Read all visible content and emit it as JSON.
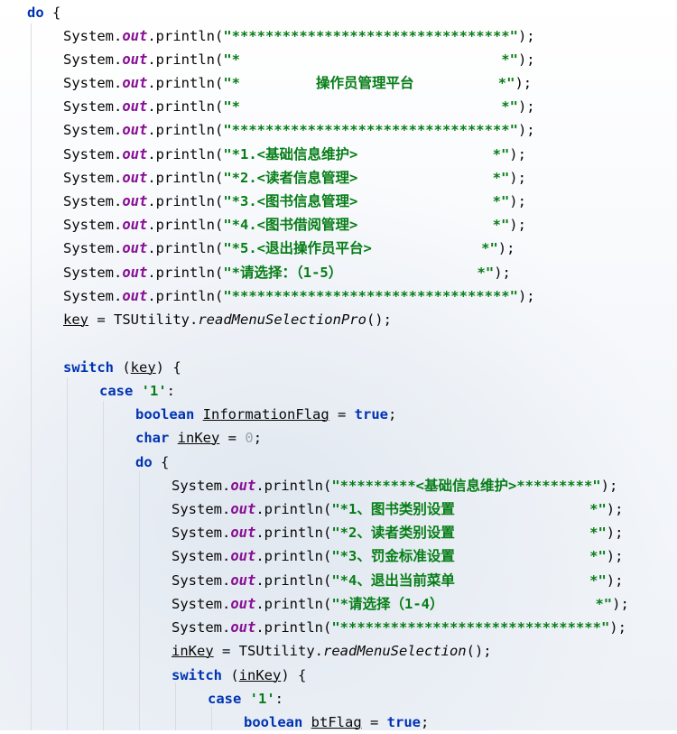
{
  "lines": [
    {
      "tokens": [
        [
          "kw",
          "do"
        ],
        [
          "p",
          " {"
        ]
      ]
    },
    {
      "tokens": [
        [
          "p",
          "System."
        ],
        [
          "fld",
          "out"
        ],
        [
          "p",
          ".println("
        ],
        [
          "str",
          "\"*********************************\""
        ],
        [
          "p",
          ");"
        ]
      ]
    },
    {
      "tokens": [
        [
          "p",
          "System."
        ],
        [
          "fld",
          "out"
        ],
        [
          "p",
          ".println("
        ],
        [
          "str",
          "\"*                               *\""
        ],
        [
          "p",
          ");"
        ]
      ]
    },
    {
      "tokens": [
        [
          "p",
          "System."
        ],
        [
          "fld",
          "out"
        ],
        [
          "p",
          ".println("
        ],
        [
          "str",
          "\"*         操作员管理平台          *\""
        ],
        [
          "p",
          ");"
        ]
      ]
    },
    {
      "tokens": [
        [
          "p",
          "System."
        ],
        [
          "fld",
          "out"
        ],
        [
          "p",
          ".println("
        ],
        [
          "str",
          "\"*                               *\""
        ],
        [
          "p",
          ");"
        ]
      ]
    },
    {
      "tokens": [
        [
          "p",
          "System."
        ],
        [
          "fld",
          "out"
        ],
        [
          "p",
          ".println("
        ],
        [
          "str",
          "\"*********************************\""
        ],
        [
          "p",
          ");"
        ]
      ]
    },
    {
      "tokens": [
        [
          "p",
          "System."
        ],
        [
          "fld",
          "out"
        ],
        [
          "p",
          ".println("
        ],
        [
          "str",
          "\"*1.<基础信息维护>                *\""
        ],
        [
          "p",
          ");"
        ]
      ]
    },
    {
      "tokens": [
        [
          "p",
          "System."
        ],
        [
          "fld",
          "out"
        ],
        [
          "p",
          ".println("
        ],
        [
          "str",
          "\"*2.<读者信息管理>                *\""
        ],
        [
          "p",
          ");"
        ]
      ]
    },
    {
      "tokens": [
        [
          "p",
          "System."
        ],
        [
          "fld",
          "out"
        ],
        [
          "p",
          ".println("
        ],
        [
          "str",
          "\"*3.<图书信息管理>                *\""
        ],
        [
          "p",
          ");"
        ]
      ]
    },
    {
      "tokens": [
        [
          "p",
          "System."
        ],
        [
          "fld",
          "out"
        ],
        [
          "p",
          ".println("
        ],
        [
          "str",
          "\"*4.<图书借阅管理>                *\""
        ],
        [
          "p",
          ");"
        ]
      ]
    },
    {
      "tokens": [
        [
          "p",
          "System."
        ],
        [
          "fld",
          "out"
        ],
        [
          "p",
          ".println("
        ],
        [
          "str",
          "\"*5.<退出操作员平台>             *\""
        ],
        [
          "p",
          ");"
        ]
      ]
    },
    {
      "tokens": [
        [
          "p",
          "System."
        ],
        [
          "fld",
          "out"
        ],
        [
          "p",
          ".println("
        ],
        [
          "str",
          "\"*请选择：（1-5）                *\""
        ],
        [
          "p",
          ");"
        ]
      ]
    },
    {
      "tokens": [
        [
          "p",
          "System."
        ],
        [
          "fld",
          "out"
        ],
        [
          "p",
          ".println("
        ],
        [
          "str",
          "\"*********************************\""
        ],
        [
          "p",
          ");"
        ]
      ]
    },
    {
      "tokens": [
        [
          "var",
          "key"
        ],
        [
          "p",
          " = TSUtility."
        ],
        [
          "ital",
          "readMenuSelectionPro"
        ],
        [
          "p",
          "();"
        ]
      ]
    },
    {
      "tokens": []
    },
    {
      "tokens": [
        [
          "kw",
          "switch"
        ],
        [
          "p",
          " ("
        ],
        [
          "var",
          "key"
        ],
        [
          "p",
          ") {"
        ]
      ]
    },
    {
      "tokens": [
        [
          "kw",
          "case"
        ],
        [
          "p",
          " "
        ],
        [
          "str",
          "'1'"
        ],
        [
          "p",
          ":"
        ]
      ]
    },
    {
      "tokens": [
        [
          "kw",
          "boolean"
        ],
        [
          "p",
          " "
        ],
        [
          "var",
          "InformationFlag"
        ],
        [
          "p",
          " = "
        ],
        [
          "kw",
          "true"
        ],
        [
          "p",
          ";"
        ]
      ]
    },
    {
      "tokens": [
        [
          "kw",
          "char"
        ],
        [
          "p",
          " "
        ],
        [
          "var",
          "inKey"
        ],
        [
          "p",
          " = "
        ],
        [
          "num-gray",
          "0"
        ],
        [
          "p",
          ";"
        ]
      ]
    },
    {
      "tokens": [
        [
          "kw",
          "do"
        ],
        [
          "p",
          " {"
        ]
      ]
    },
    {
      "tokens": [
        [
          "p",
          "System."
        ],
        [
          "fld",
          "out"
        ],
        [
          "p",
          ".println("
        ],
        [
          "str",
          "\"*********<基础信息维护>*********\""
        ],
        [
          "p",
          ");"
        ]
      ]
    },
    {
      "tokens": [
        [
          "p",
          "System."
        ],
        [
          "fld",
          "out"
        ],
        [
          "p",
          ".println("
        ],
        [
          "str",
          "\"*1、图书类别设置                *\""
        ],
        [
          "p",
          ");"
        ]
      ]
    },
    {
      "tokens": [
        [
          "p",
          "System."
        ],
        [
          "fld",
          "out"
        ],
        [
          "p",
          ".println("
        ],
        [
          "str",
          "\"*2、读者类别设置                *\""
        ],
        [
          "p",
          ");"
        ]
      ]
    },
    {
      "tokens": [
        [
          "p",
          "System."
        ],
        [
          "fld",
          "out"
        ],
        [
          "p",
          ".println("
        ],
        [
          "str",
          "\"*3、罚金标准设置                *\""
        ],
        [
          "p",
          ");"
        ]
      ]
    },
    {
      "tokens": [
        [
          "p",
          "System."
        ],
        [
          "fld",
          "out"
        ],
        [
          "p",
          ".println("
        ],
        [
          "str",
          "\"*4、退出当前菜单                *\""
        ],
        [
          "p",
          ");"
        ]
      ]
    },
    {
      "tokens": [
        [
          "p",
          "System."
        ],
        [
          "fld",
          "out"
        ],
        [
          "p",
          ".println("
        ],
        [
          "str",
          "\"*请选择（1-4）                  *\""
        ],
        [
          "p",
          ");"
        ]
      ]
    },
    {
      "tokens": [
        [
          "p",
          "System."
        ],
        [
          "fld",
          "out"
        ],
        [
          "p",
          ".println("
        ],
        [
          "str",
          "\"*******************************\""
        ],
        [
          "p",
          ");"
        ]
      ]
    },
    {
      "tokens": [
        [
          "var",
          "inKey"
        ],
        [
          "p",
          " = TSUtility."
        ],
        [
          "ital",
          "readMenuSelection"
        ],
        [
          "p",
          "();"
        ]
      ]
    },
    {
      "tokens": [
        [
          "kw",
          "switch"
        ],
        [
          "p",
          " ("
        ],
        [
          "var",
          "inKey"
        ],
        [
          "p",
          ") {"
        ]
      ]
    },
    {
      "tokens": [
        [
          "kw",
          "case"
        ],
        [
          "p",
          " "
        ],
        [
          "str",
          "'1'"
        ],
        [
          "p",
          ":"
        ]
      ]
    },
    {
      "tokens": [
        [
          "kw",
          "boolean"
        ],
        [
          "p",
          " "
        ],
        [
          "var",
          "btFlag"
        ],
        [
          "p",
          " = "
        ],
        [
          "kw",
          "true"
        ],
        [
          "p",
          ";"
        ]
      ]
    }
  ]
}
